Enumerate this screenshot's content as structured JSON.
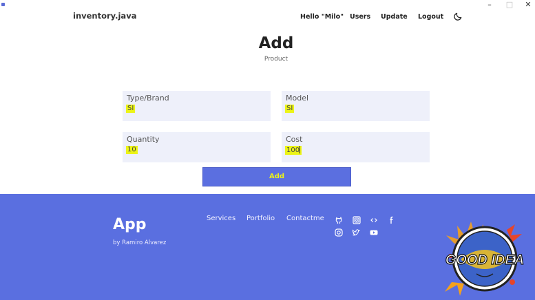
{
  "window": {
    "minimize": "–",
    "maximize": "□",
    "close": "✕"
  },
  "nav": {
    "brand": "inventory.java",
    "hello": "Hello \"Milo\"",
    "users": "Users",
    "update": "Update",
    "logout": "Logout",
    "theme_icon": "moon-icon"
  },
  "header": {
    "title": "Add",
    "subtitle": "Product"
  },
  "form": {
    "type_brand": {
      "label": "Type/Brand",
      "value": "SI"
    },
    "model": {
      "label": "Model",
      "value": "SI"
    },
    "quantity": {
      "label": "Quantity",
      "value": "10"
    },
    "cost": {
      "label": "Cost",
      "value": "100"
    },
    "submit_label": "Add"
  },
  "footer": {
    "app_name": "App",
    "byline": "by Ramiro Alvarez",
    "links": [
      "Services",
      "Portfolio",
      "Contactme"
    ],
    "social_icons": [
      "github-icon",
      "instagram-square-icon",
      "code-icon",
      "facebook-icon",
      "instagram-icon",
      "twitter-icon",
      "youtube-icon"
    ],
    "logo_text": "GOOD IDEA"
  },
  "colors": {
    "accent": "#5a6fe0",
    "highlight": "#ecf417",
    "field_bg": "#eef0fa"
  }
}
